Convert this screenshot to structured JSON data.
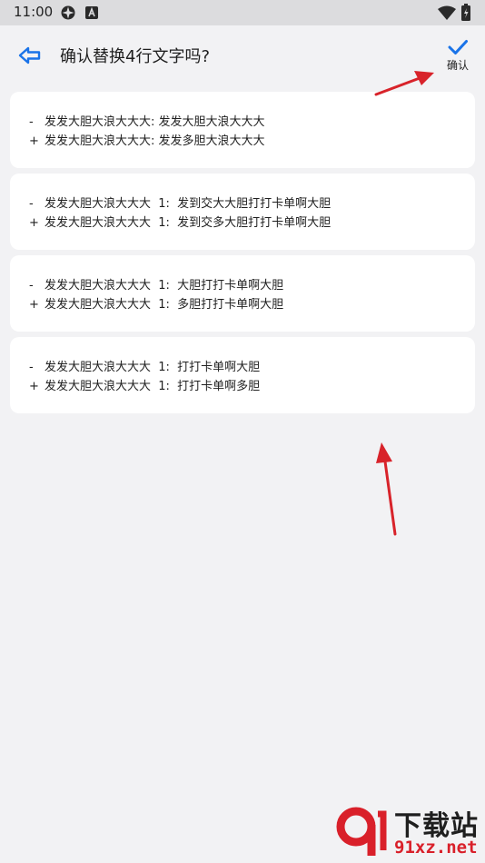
{
  "status_bar": {
    "time": "11:00",
    "icons": [
      "sync-icon",
      "keyboard-a-icon",
      "wifi-icon",
      "battery-charging-icon"
    ]
  },
  "header": {
    "back_icon": "arrow-left-icon",
    "title": "确认替换4行文字吗?",
    "confirm_icon": "check-icon",
    "confirm_label": "确认"
  },
  "colors": {
    "accent": "#1a73e8",
    "background": "#f2f2f4",
    "card": "#ffffff",
    "annotation_arrow": "#d8232a"
  },
  "diffs": [
    {
      "removed": {
        "sign": "-",
        "text": "发发大胆大浪大大大: 发发大胆大浪大大大"
      },
      "added": {
        "sign": "+",
        "text": "发发大胆大浪大大大: 发发多胆大浪大大大"
      }
    },
    {
      "removed": {
        "sign": "-",
        "text": "发发大胆大浪大大大  1:  发到交大大胆打打卡单啊大胆"
      },
      "added": {
        "sign": "+",
        "text": "发发大胆大浪大大大  1:  发到交多大胆打打卡单啊大胆"
      }
    },
    {
      "removed": {
        "sign": "-",
        "text": "发发大胆大浪大大大  1:  大胆打打卡单啊大胆"
      },
      "added": {
        "sign": "+",
        "text": "发发大胆大浪大大大  1:  多胆打打卡单啊大胆"
      }
    },
    {
      "removed": {
        "sign": "-",
        "text": "发发大胆大浪大大大  1:  打打卡单啊大胆"
      },
      "added": {
        "sign": "+",
        "text": "发发大胆大浪大大大  1:  打打卡单啊多胆"
      }
    }
  ],
  "watermark": {
    "title": "下载站",
    "site": "91xz.net"
  }
}
